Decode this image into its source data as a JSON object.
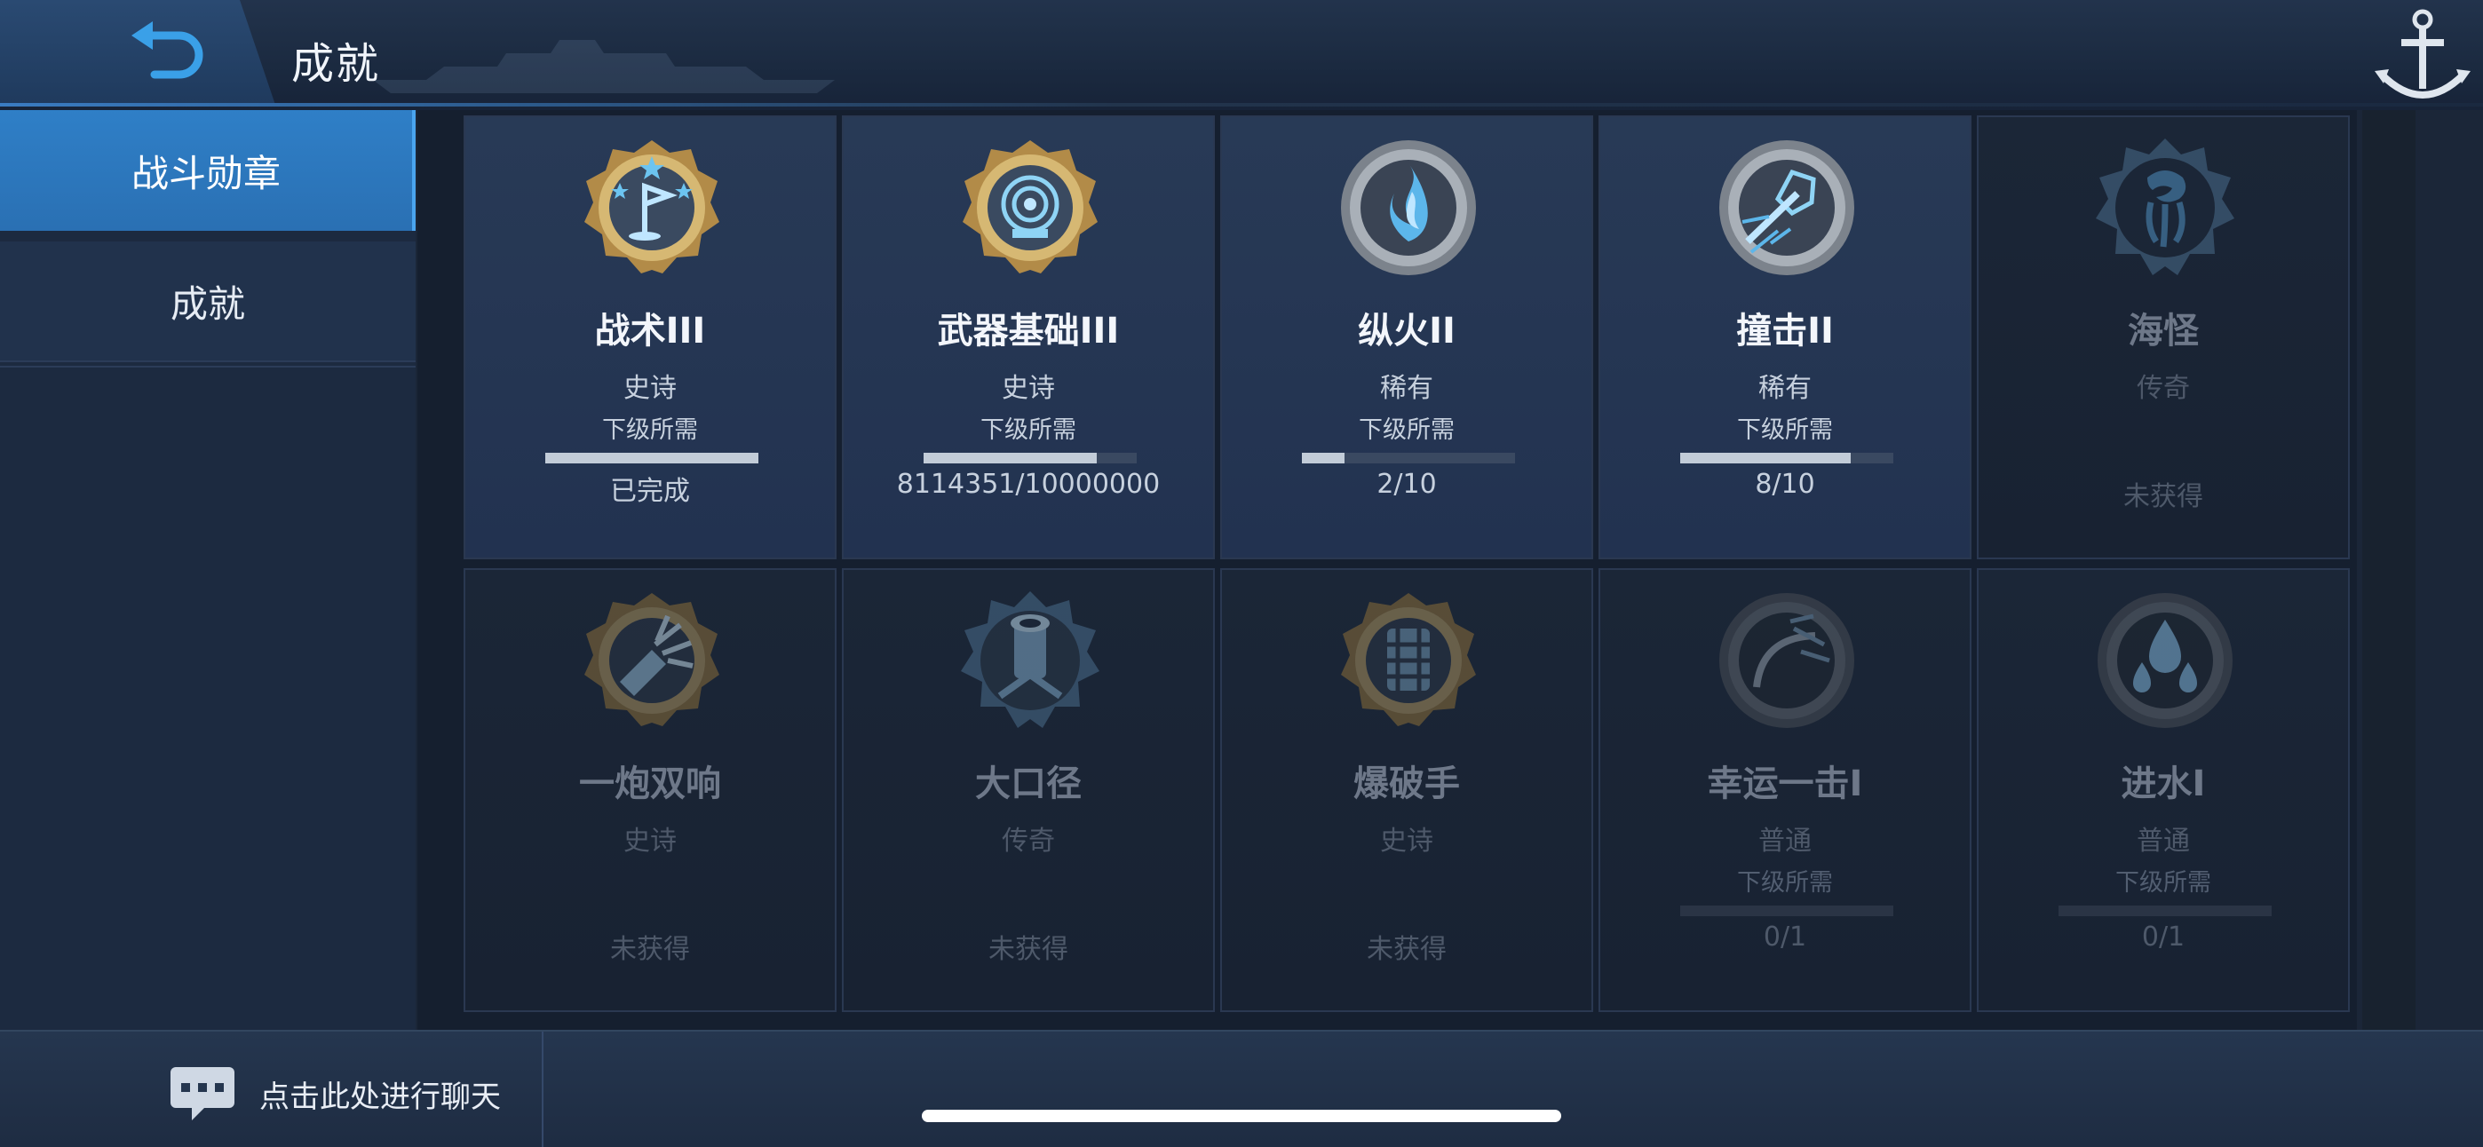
{
  "header": {
    "title": "成就"
  },
  "sidebar": {
    "tabs": [
      {
        "label": "战斗勋章",
        "active": true
      },
      {
        "label": "成就",
        "active": false
      }
    ]
  },
  "medals": [
    {
      "name": "战术III",
      "rarity": "史诗",
      "next_label": "下级所需",
      "progress_text": "已完成",
      "progress": 1.0,
      "status": "",
      "obtained": true,
      "icon": "flag-stars-medal-icon"
    },
    {
      "name": "武器基础III",
      "rarity": "史诗",
      "next_label": "下级所需",
      "progress_text": "8114351/10000000",
      "progress": 0.8114,
      "status": "",
      "obtained": true,
      "icon": "target-medal-icon"
    },
    {
      "name": "纵火II",
      "rarity": "稀有",
      "next_label": "下级所需",
      "progress_text": "2/10",
      "progress": 0.2,
      "status": "",
      "obtained": true,
      "icon": "flame-medal-icon"
    },
    {
      "name": "撞击II",
      "rarity": "稀有",
      "next_label": "下级所需",
      "progress_text": "8/10",
      "progress": 0.8,
      "status": "",
      "obtained": true,
      "icon": "ram-medal-icon"
    },
    {
      "name": "海怪",
      "rarity": "传奇",
      "next_label": "",
      "progress_text": "",
      "progress": null,
      "status": "未获得",
      "obtained": false,
      "icon": "kraken-medal-icon"
    },
    {
      "name": "一炮双响",
      "rarity": "史诗",
      "next_label": "",
      "progress_text": "",
      "progress": null,
      "status": "未获得",
      "obtained": false,
      "icon": "double-shot-medal-icon"
    },
    {
      "name": "大口径",
      "rarity": "传奇",
      "next_label": "",
      "progress_text": "",
      "progress": null,
      "status": "未获得",
      "obtained": false,
      "icon": "cannon-medal-icon"
    },
    {
      "name": "爆破手",
      "rarity": "史诗",
      "next_label": "",
      "progress_text": "",
      "progress": null,
      "status": "未获得",
      "obtained": false,
      "icon": "demolition-medal-icon"
    },
    {
      "name": "幸运一击I",
      "rarity": "普通",
      "next_label": "下级所需",
      "progress_text": "0/1",
      "progress": 0.0,
      "status": "",
      "obtained": false,
      "icon": "lucky-hit-medal-icon"
    },
    {
      "name": "进水I",
      "rarity": "普通",
      "next_label": "下级所需",
      "progress_text": "0/1",
      "progress": 0.0,
      "status": "",
      "obtained": false,
      "icon": "flooding-medal-icon"
    }
  ],
  "chat": {
    "label": "点击此处进行聊天"
  },
  "colors": {
    "accent": "#2f7fc7",
    "gold": "#c8a25a",
    "silver": "#9aa3ad",
    "glow": "#5fb8e8"
  }
}
